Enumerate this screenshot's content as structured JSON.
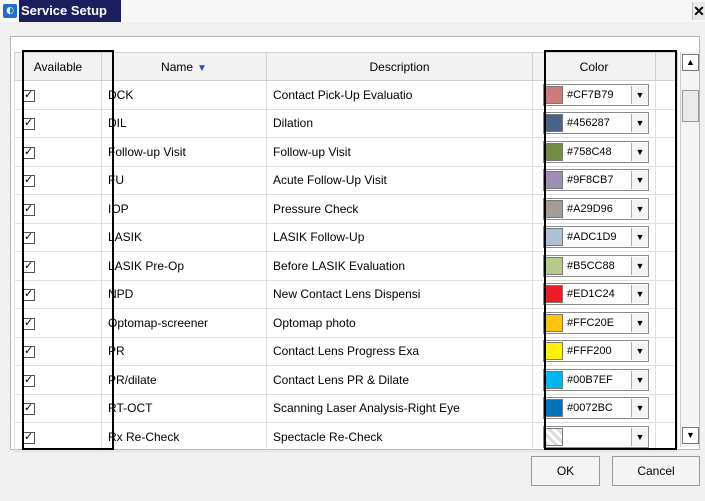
{
  "window": {
    "title": "Service Setup",
    "close_label": "✕"
  },
  "grid": {
    "columns": {
      "available": "Available",
      "name": "Name",
      "description": "Description",
      "color": "Color"
    },
    "sort_icon": "sort-descending-icon",
    "rows": [
      {
        "name": "DCK",
        "description": "Contact Pick-Up Evaluatio",
        "color": "#CF7B79"
      },
      {
        "name": "DIL",
        "description": "Dilation",
        "color": "#456287"
      },
      {
        "name": "Follow-up Visit",
        "description": "Follow-up Visit",
        "color": "#758C48"
      },
      {
        "name": "FU",
        "description": "Acute Follow-Up Visit",
        "color": "#9F8CB7"
      },
      {
        "name": "IOP",
        "description": "Pressure Check",
        "color": "#A29D96"
      },
      {
        "name": "LASIK",
        "description": "LASIK Follow-Up",
        "color": "#ADC1D9"
      },
      {
        "name": "LASIK Pre-Op",
        "description": "Before LASIK Evaluation",
        "color": "#B5CC88"
      },
      {
        "name": "NPD",
        "description": "New Contact Lens Dispensi",
        "color": "#ED1C24"
      },
      {
        "name": "Optomap-screener",
        "description": "Optomap photo",
        "color": "#FFC20E"
      },
      {
        "name": "PR",
        "description": "Contact Lens Progress Exa",
        "color": "#FFF200"
      },
      {
        "name": "PR/dilate",
        "description": " Contact Lens PR & Dilate",
        "color": "#00B7EF"
      },
      {
        "name": "RT-OCT",
        "description": "Scanning Laser Analysis-Right Eye",
        "color": "#0072BC"
      },
      {
        "name": "Rx Re-Check",
        "description": "Spectacle Re-Check",
        "color": ""
      }
    ]
  },
  "buttons": {
    "ok": "OK",
    "cancel": "Cancel"
  }
}
